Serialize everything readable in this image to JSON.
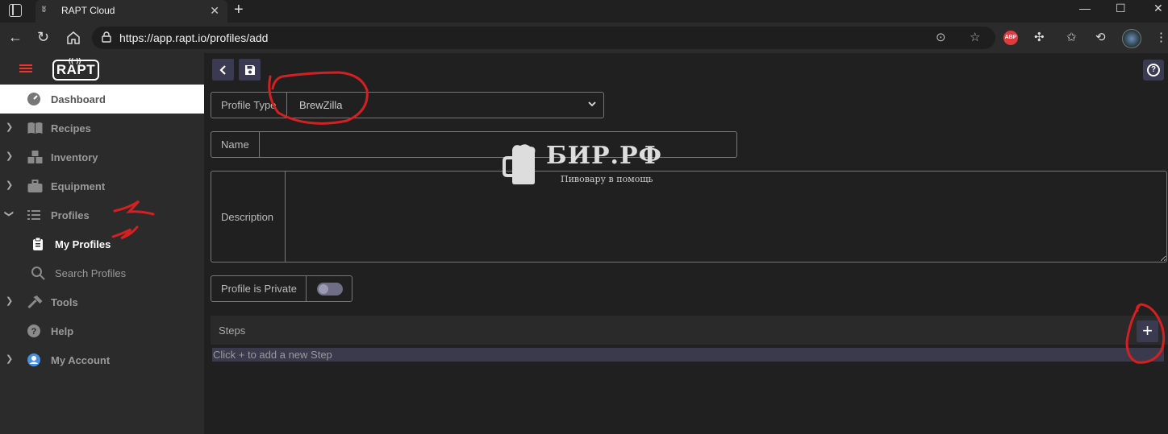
{
  "browser": {
    "tab_title": "RAPT Cloud",
    "url": "https://app.rapt.io/profiles/add",
    "tab_close": "✕",
    "new_tab": "+",
    "win_min": "—",
    "win_max": "☐",
    "win_close": "✕"
  },
  "app": {
    "logo": "RAPT",
    "sidebar": {
      "items": [
        {
          "label": "Dashboard"
        },
        {
          "label": "Recipes"
        },
        {
          "label": "Inventory"
        },
        {
          "label": "Equipment"
        },
        {
          "label": "Profiles"
        },
        {
          "label": "My Profiles"
        },
        {
          "label": "Search Profiles"
        },
        {
          "label": "Tools"
        },
        {
          "label": "Help"
        },
        {
          "label": "My Account"
        }
      ]
    },
    "form": {
      "profile_type_label": "Profile Type",
      "profile_type_value": "BrewZilla",
      "name_label": "Name",
      "name_value": "",
      "description_label": "Description",
      "private_label": "Profile is Private",
      "private_on": false
    },
    "steps": {
      "title": "Steps",
      "add_label": "+",
      "hint": "Click + to add a new Step"
    }
  },
  "watermark": {
    "title": "БИР.РФ",
    "subtitle": "Пивовару в помощь"
  },
  "colors": {
    "accent_red": "#e33333",
    "button_bg": "#3a3a50",
    "sidebar_bg": "#2b2b2b",
    "main_bg": "#202020"
  }
}
